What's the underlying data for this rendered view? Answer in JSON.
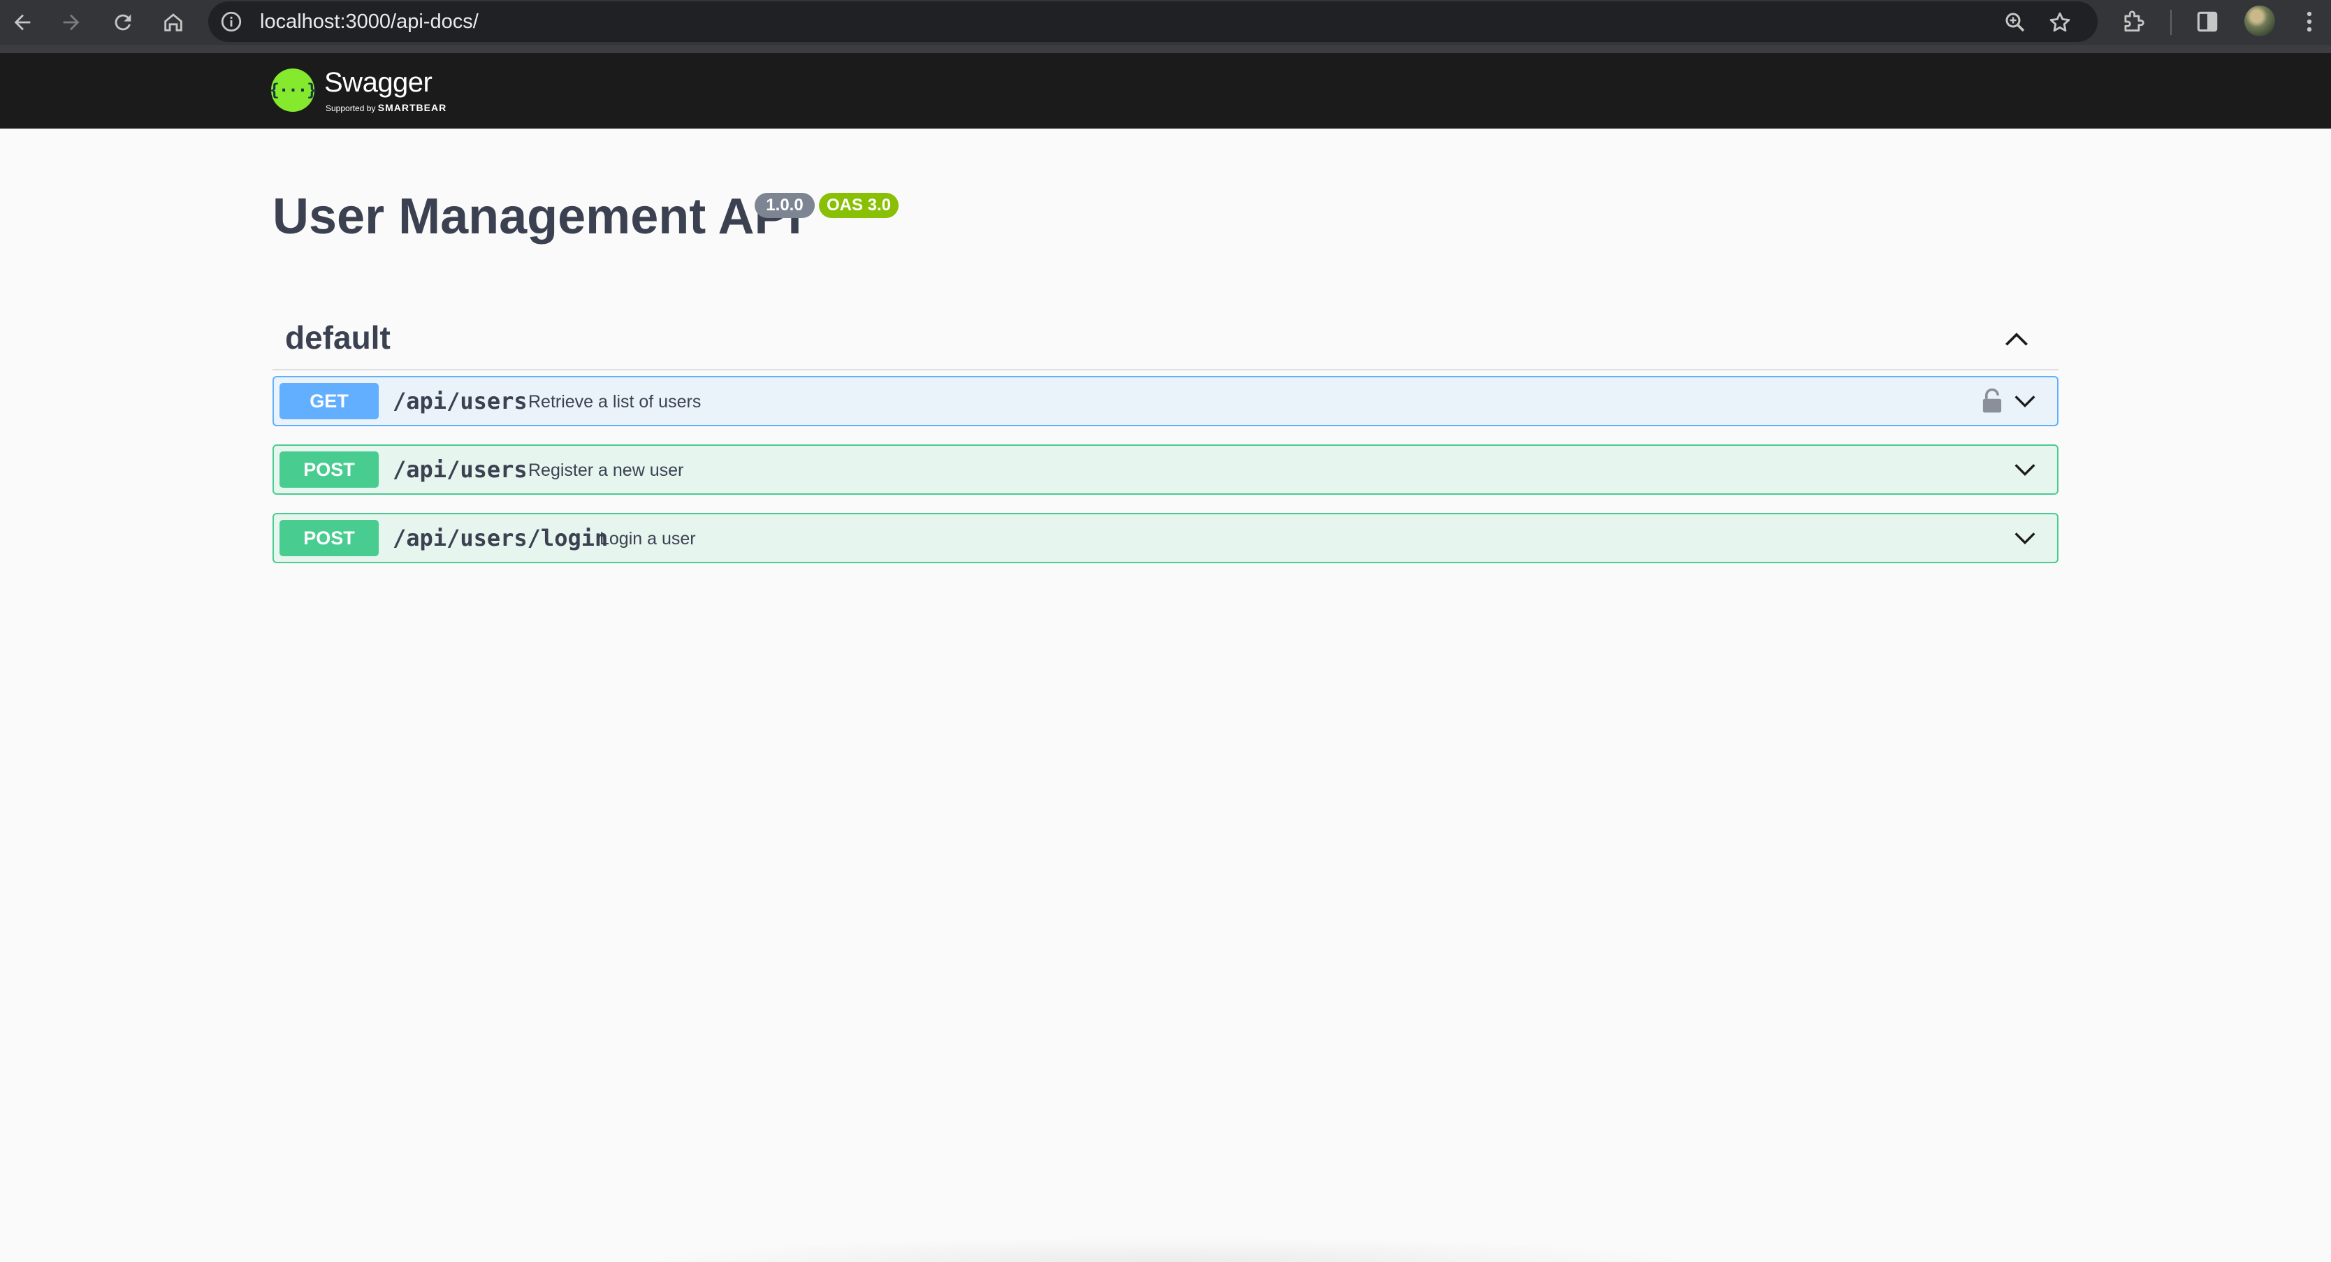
{
  "browser": {
    "url": "localhost:3000/api-docs/",
    "icons": [
      "back-arrow-icon",
      "forward-arrow-icon",
      "reload-icon",
      "home-icon",
      "site-info-icon",
      "zoom-icon",
      "bookmark-star-icon",
      "extensions-icon",
      "side-panel-icon",
      "avatar",
      "kebab-menu-icon"
    ]
  },
  "topbar": {
    "logo_name": "Swagger",
    "logo_glyph": "{···}",
    "supported_by": "Supported by",
    "smartbear": "SMARTBEAR"
  },
  "info": {
    "title": "User Management API",
    "version": "1.0.0",
    "oas": "OAS 3.0"
  },
  "tag": {
    "name": "default"
  },
  "operations": [
    {
      "method": "GET",
      "path": "/api/users",
      "summary": "Retrieve a list of users",
      "locked": true
    },
    {
      "method": "POST",
      "path": "/api/users",
      "summary": "Register a new user",
      "locked": false
    },
    {
      "method": "POST",
      "path": "/api/users/login",
      "summary": "Login a user",
      "locked": false
    }
  ],
  "colors": {
    "get": "#61affe",
    "post": "#49cc90",
    "version_badge": "#7d8492",
    "oas_badge": "#89bf04",
    "swagger_green": "#85ea2d",
    "topbar": "#1b1b1b"
  }
}
